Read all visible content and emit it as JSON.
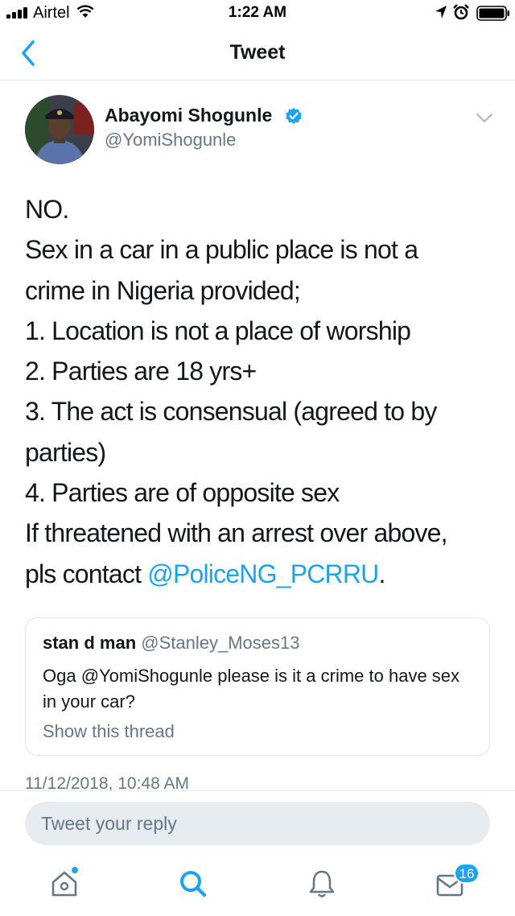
{
  "status_bar": {
    "carrier": "Airtel",
    "time": "1:22 AM"
  },
  "nav": {
    "title": "Tweet",
    "back_icon": "chevron-left-icon"
  },
  "tweet": {
    "author_name": "Abayomi Shogunle",
    "author_handle": "@YomiShogunle",
    "verified": true,
    "lines": [
      "NO.",
      "Sex in a car in a public place is not a",
      "crime in Nigeria provided;",
      "1. Location is not a place of worship",
      "2. Parties are 18 yrs+",
      "3. The act is consensual (agreed to by",
      "parties)",
      "4. Parties are of opposite sex",
      "If threatened with an arrest over above,"
    ],
    "last_line_prefix": "pls contact ",
    "last_line_mention": "@PoliceNG_PCRRU",
    "last_line_suffix": ".",
    "timestamp": "11/12/2018, 10:48 AM"
  },
  "quoted_tweet": {
    "name": "stan d man",
    "handle": "@Stanley_Moses13",
    "text": "Oga @YomiShogunle please is it a crime to have sex in your car?",
    "show_thread": "Show this thread"
  },
  "reply": {
    "placeholder": "Tweet your reply"
  },
  "tab_bar": {
    "items": [
      "home-icon",
      "search-icon",
      "notifications-icon",
      "messages-icon"
    ],
    "messages_badge": "16"
  },
  "colors": {
    "accent": "#1da1f2",
    "secondary_text": "#657786",
    "primary_text": "#14171a"
  }
}
